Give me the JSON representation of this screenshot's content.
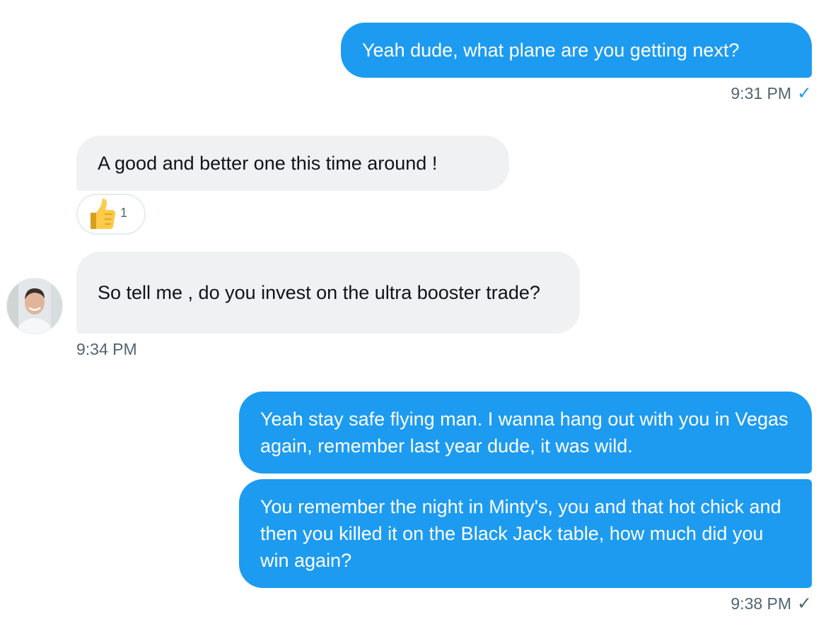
{
  "messages": [
    {
      "direction": "outgoing",
      "text": "Yeah dude, what plane are you getting next?"
    },
    {
      "direction": "incoming",
      "text": "A good and better one this time around !"
    },
    {
      "direction": "incoming",
      "text": "So tell me , do you invest on the ultra booster trade?"
    },
    {
      "direction": "outgoing",
      "text": "Yeah stay safe flying man. I wanna hang out with you in Vegas again, remember last year dude, it was wild."
    },
    {
      "direction": "outgoing",
      "text": "You remember the night in Minty's, you and that hot chick and then you killed it on the Black Jack table, how much did you win again?"
    }
  ],
  "timestamps": {
    "first": "9:31 PM",
    "second": "9:34 PM",
    "third": "9:38 PM"
  },
  "reaction": {
    "icon": "thumbs-up-icon",
    "count": "1"
  },
  "status_icons": {
    "first": "check-icon",
    "third": "check-icon"
  },
  "colors": {
    "outgoing_bubble": "#1d9bf0",
    "incoming_bubble": "#eff1f3",
    "timestamp": "#536471",
    "read_check": "#1d9bf0",
    "sent_check": "#536471"
  }
}
